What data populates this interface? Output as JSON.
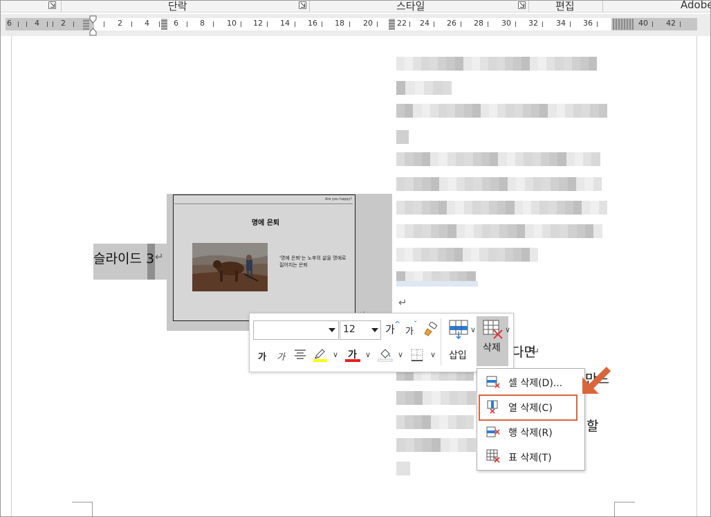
{
  "ribbon": {
    "groups": [
      "단락",
      "스타일",
      "편집",
      "Adobe"
    ]
  },
  "ruler": {
    "left_numbers": [
      "6",
      "4",
      "2"
    ],
    "numbers": [
      "2",
      "4",
      "6",
      "8",
      "10",
      "12",
      "14",
      "16",
      "18",
      "20",
      "22",
      "24",
      "26",
      "28",
      "30",
      "32",
      "34",
      "36",
      "40",
      "42"
    ]
  },
  "document": {
    "slide_label": "슬라이드 3",
    "slide": {
      "top_text": "Are you happy?",
      "title": "명에 은퇴",
      "body": "'명에 은퇴'는 노후의 삶을 명에로 짊어지는 은퇴"
    },
    "visible_text": {
      "line1_tail": "다면",
      "line2_tail": "만드",
      "line4_tail": "할"
    }
  },
  "mini_toolbar": {
    "font_name": "",
    "font_size": "12",
    "grow_font": "가",
    "shrink_font": "가",
    "bold": "가",
    "italic": "가",
    "font_color_letter": "가",
    "insert_label": "삽입",
    "delete_label": "삭제"
  },
  "delete_menu": {
    "items": [
      {
        "label": "셀 삭제(D)...",
        "icon": "delete-cells-icon"
      },
      {
        "label": "열 삭제(C)",
        "icon": "delete-column-icon"
      },
      {
        "label": "행 삭제(R)",
        "icon": "delete-row-icon"
      },
      {
        "label": "표 삭제(T)",
        "icon": "delete-table-icon"
      }
    ],
    "highlighted_index": 1
  },
  "colors": {
    "accent_orange": "#d9663b",
    "highlight_yellow": "#ffff00",
    "font_red": "#e02020",
    "delete_red": "#d93a3a",
    "insert_blue": "#2b7cd3"
  }
}
